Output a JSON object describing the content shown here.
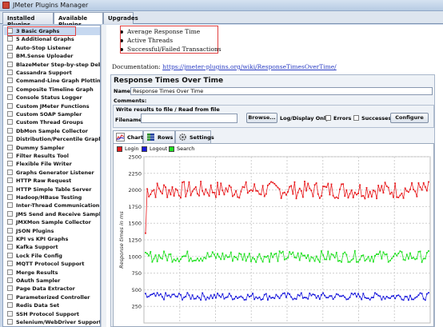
{
  "window": {
    "title": "JMeter Plugins Manager"
  },
  "tabs": [
    {
      "label": "Installed Plugins"
    },
    {
      "label": "Available Plugins"
    },
    {
      "label": "Upgrades"
    }
  ],
  "plugins": [
    "3 Basic Graphs",
    "5 Additional Graphs",
    "Auto-Stop Listener",
    "BM.Sense Uploader",
    "BlazeMeter Step-by-step Debugger",
    "Cassandra Support",
    "Command-Line Graph Plotting Tool",
    "Composite Timeline Graph",
    "Console Status Logger",
    "Custom JMeter Functions",
    "Custom SOAP Sampler",
    "Custom Thread Groups",
    "DbMon Sample Collector",
    "Distribution/Percentile Graphs",
    "Dummy Sampler",
    "Filter Results Tool",
    "Flexible File Writer",
    "Graphs Generator Listener",
    "HTTP Raw Request",
    "HTTP Simple Table Server",
    "Hadoop/HBase Testing",
    "Inter-Thread Communication",
    "JMS Send and Receive Sampler",
    "JMXMon Sample Collector",
    "JSON Plugins",
    "KPI vs KPI Graphs",
    "Kafka Support",
    "Lock File Config",
    "MQTT Protocol Support",
    "Merge Results",
    "OAuth Sampler",
    "Page Data Extractor",
    "Parameterized Controller",
    "Redis Data Set",
    "SSH Protocol Support",
    "Selenium/WebDriver Support"
  ],
  "description": {
    "bullets": [
      "Average Response Time",
      "Active Threads",
      "Successful/Failed Transactions"
    ],
    "doc_label": "Documentation: ",
    "doc_link": "https://jmeter-plugins.org/wiki/ResponseTimesOverTime/"
  },
  "listener": {
    "title": "Response Times Over Time",
    "name_label": "Name:",
    "name_value": "Response Times Over Time",
    "comments_label": "Comments:",
    "file_section_title": "Write results to file / Read from file",
    "filename_label": "Filename",
    "browse_label": "Browse...",
    "logdisplay_label": "Log/Display Only:",
    "errors_label": "Errors",
    "successes_label": "Successes",
    "configure_label": "Configure",
    "tabs": [
      "Chart",
      "Rows",
      "Settings"
    ]
  },
  "chart_data": {
    "type": "line",
    "ylabel": "Response times in ms",
    "ylim": [
      0,
      2500
    ],
    "yticks": [
      2500,
      2250,
      2000,
      1750,
      1500,
      1250,
      1000,
      750,
      500,
      250
    ],
    "series": [
      {
        "name": "Login",
        "color": "#e8191c",
        "mean": 2000,
        "spread": 130
      },
      {
        "name": "Logout",
        "color": "#1a1adc",
        "mean": 400,
        "spread": 55
      },
      {
        "name": "Search",
        "color": "#1fe01f",
        "mean": 1000,
        "spread": 85
      }
    ]
  }
}
